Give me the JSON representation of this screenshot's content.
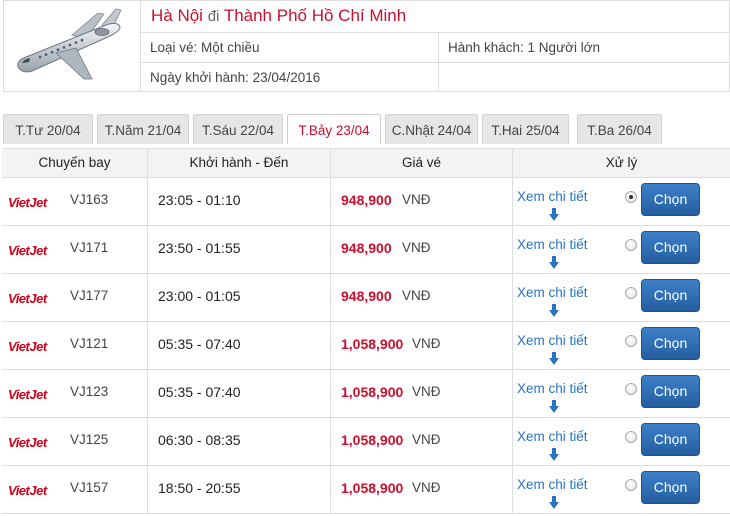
{
  "route": {
    "from": "Hà Nội",
    "connector": "đi",
    "to": "Thành Phố Hồ Chí Minh"
  },
  "info": {
    "ticket_type": "Loại vé: Một chiều",
    "passengers": "Hành khách: 1 Người lớn",
    "departure_date": "Ngày khởi hành: 23/04/2016"
  },
  "tabs": [
    {
      "label": "T.Tư 20/04",
      "active": false
    },
    {
      "label": "T.Năm 21/04",
      "active": false
    },
    {
      "label": "T.Sáu 22/04",
      "active": false
    },
    {
      "label": "T.Bảy 23/04",
      "active": true
    },
    {
      "label": "C.Nhật 24/04",
      "active": false
    },
    {
      "label": "T.Hai 25/04",
      "active": false
    },
    {
      "label": "T.Ba 26/04",
      "active": false
    }
  ],
  "columns": {
    "flight": "Chuyến bay",
    "time": "Khởi hành - Đến",
    "price": "Giá vé",
    "action": "Xử lý"
  },
  "airline_logo": "VietJet",
  "currency": "VNĐ",
  "detail_label": "Xem chi tiết",
  "choose_label": "Chọn",
  "icons": {
    "plane": "airplane-icon",
    "arrow": "arrow-down-icon"
  },
  "colors": {
    "accent_red": "#c8102e",
    "link_blue": "#2b72c0",
    "button_blue": "#2f6fb3"
  },
  "flights": [
    {
      "code": "VJ163",
      "time": "23:05 - 01:10",
      "price": "948,900",
      "selected": true
    },
    {
      "code": "VJ171",
      "time": "23:50 - 01:55",
      "price": "948,900",
      "selected": false
    },
    {
      "code": "VJ177",
      "time": "23:00 - 01:05",
      "price": "948,900",
      "selected": false
    },
    {
      "code": "VJ121",
      "time": "05:35 - 07:40",
      "price": "1,058,900",
      "selected": false
    },
    {
      "code": "VJ123",
      "time": "05:35 - 07:40",
      "price": "1,058,900",
      "selected": false
    },
    {
      "code": "VJ125",
      "time": "06:30 - 08:35",
      "price": "1,058,900",
      "selected": false
    },
    {
      "code": "VJ157",
      "time": "18:50 - 20:55",
      "price": "1,058,900",
      "selected": false
    }
  ]
}
